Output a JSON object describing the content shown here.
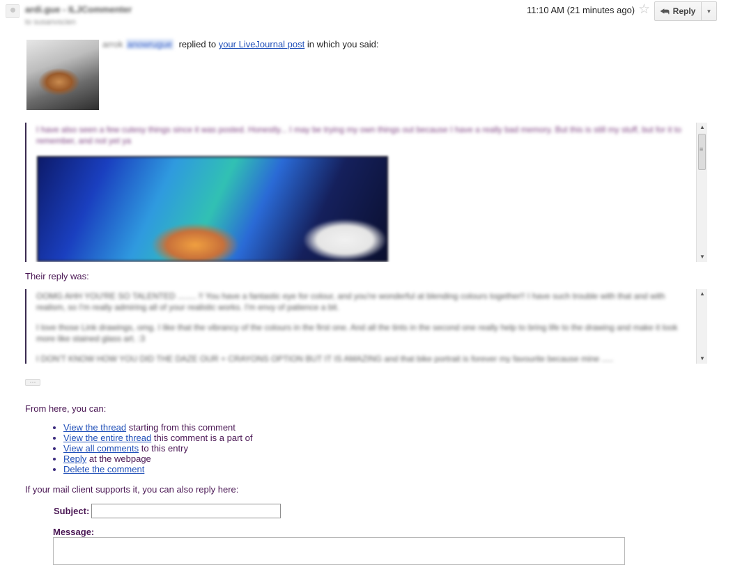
{
  "header": {
    "sender_name": "ardi.gue - ILJCommenter",
    "sender_to": "to susanvscien",
    "timestamp": "11:10 AM (21 minutes ago)",
    "reply_label": "Reply"
  },
  "intro": {
    "poster_prefix": "arrok",
    "poster_name": "anowrugue",
    "text_before_link": "replied to",
    "link_text": "your LiveJournal post",
    "text_after_link": "in which you said:"
  },
  "quote": {
    "text": "I have also seen a few cutesy things since it was posted. Honestly... I may be trying my own things out because I have a really bad memory. But this is still my stuff, but for it to remember, and not yet ya"
  },
  "reply_section": {
    "label": "Their reply was:",
    "paragraphs": [
      "OOMG AHH YOU'RE SO TALENTED ........ !! You have a fantastic eye for colour, and you're wonderful at blending colours together!! I have such trouble with that and with realism, so I'm really admiring all of your realistic works. I'm envy of patience a bit.",
      "I love those Link drawings, omg. I like that the vibrancy of the colours in the first one. And all the tints in the second one really help to bring life to the drawing and make it look more like stained glass art. :3",
      "I DON'T KNOW HOW YOU DID THE DAZE OUR + CRAYONS OPTION BUT IT IS AMAZING and that bike portrait is forever my favourite because mine ....."
    ]
  },
  "actions_section": {
    "label": "From here, you can:",
    "items": [
      {
        "link": "View the thread",
        "rest": "starting from this comment"
      },
      {
        "link": "View the entire thread",
        "rest": "this comment is a part of"
      },
      {
        "link": "View all comments",
        "rest": "to this entry"
      },
      {
        "link": "Reply",
        "rest": "at the webpage"
      },
      {
        "link": "Delete the comment",
        "rest": ""
      }
    ]
  },
  "reply_form": {
    "intro": "If your mail client supports it, you can also reply here:",
    "subject_label": "Subject:",
    "subject_value": "",
    "message_label": "Message:",
    "message_value": ""
  }
}
